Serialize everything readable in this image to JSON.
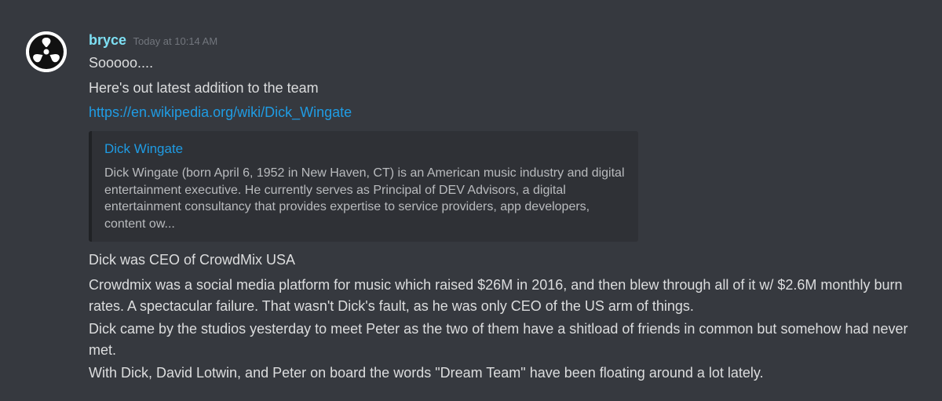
{
  "message": {
    "author": {
      "username": "bryce",
      "avatar_icon": "record-45-adapter-icon"
    },
    "timestamp": "Today at 10:14 AM",
    "lines": [
      "Sooooo....",
      "Here's out latest addition to the team"
    ],
    "link": "https://en.wikipedia.org/wiki/Dick_Wingate",
    "embed": {
      "title": "Dick Wingate",
      "description": "Dick Wingate (born April 6, 1952 in New Haven, CT) is an American music industry and digital entertainment executive. He currently serves as Principal of DEV Advisors, a digital entertainment consultancy that provides expertise to service providers, app developers, content ow..."
    },
    "paragraphs": [
      "Dick was CEO of CrowdMix USA",
      "Crowdmix was a social media platform for music which raised $26M in 2016, and then blew through all of it w/ $2.6M monthly burn rates.  A spectacular failure.  That wasn't Dick's fault, as he was only CEO of the US arm of things.",
      "Dick came by the studios yesterday to meet Peter as the two of them have a shitload of friends in common but somehow had never met.",
      "With Dick, David Lotwin, and Peter on board the words \"Dream Team\" have been floating around a lot lately."
    ]
  },
  "colors": {
    "background": "#36393f",
    "username": "#7ee0f4",
    "link": "#1f9ce4",
    "text": "#dcddde",
    "muted": "#72767d",
    "embed_bg": "#2f3136"
  }
}
